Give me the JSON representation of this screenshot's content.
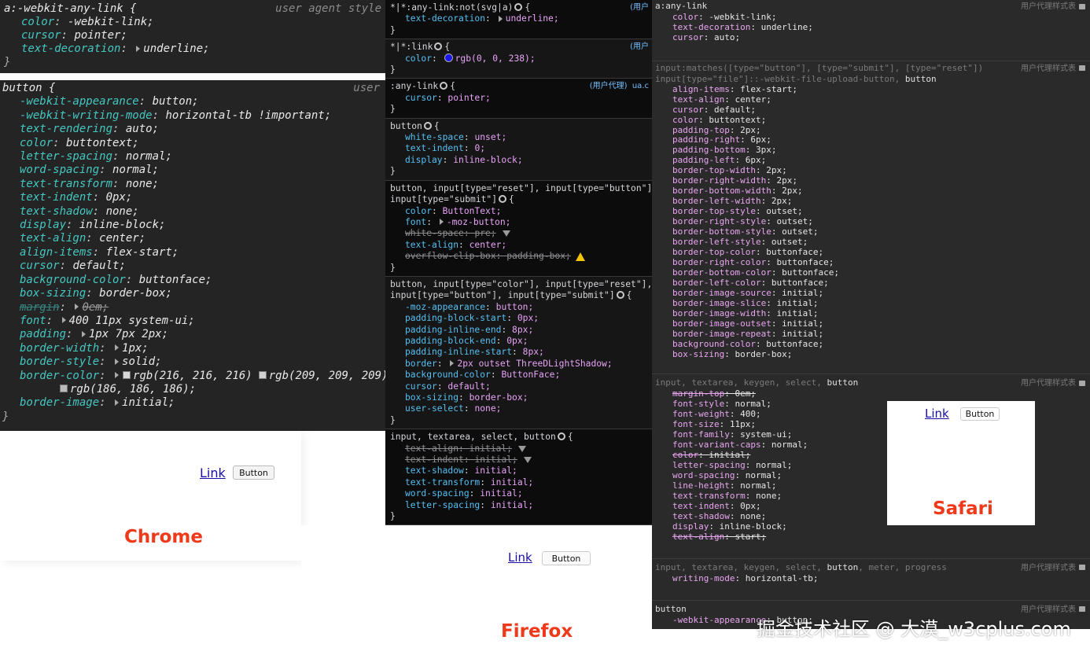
{
  "chrome": {
    "rule1": {
      "selector": "a:-webkit-any-link {",
      "source": "user agent style",
      "decls": [
        [
          "color",
          "-webkit-link;"
        ],
        [
          "cursor",
          "pointer;"
        ],
        [
          "text-decoration",
          "underline;"
        ]
      ],
      "close": "}"
    },
    "rule2": {
      "selector": "button {",
      "source": "user",
      "decls": [
        [
          "-webkit-appearance",
          "button;"
        ],
        [
          "-webkit-writing-mode",
          "horizontal-tb !important;"
        ],
        [
          "text-rendering",
          "auto;"
        ],
        [
          "color",
          "buttontext;"
        ],
        [
          "letter-spacing",
          "normal;"
        ],
        [
          "word-spacing",
          "normal;"
        ],
        [
          "text-transform",
          "none;"
        ],
        [
          "text-indent",
          "0px;"
        ],
        [
          "text-shadow",
          "none;"
        ],
        [
          "display",
          "inline-block;"
        ],
        [
          "text-align",
          "center;"
        ],
        [
          "align-items",
          "flex-start;"
        ],
        [
          "cursor",
          "default;"
        ],
        [
          "background-color",
          "buttonface;"
        ],
        [
          "box-sizing",
          "border-box;"
        ],
        [
          "margin",
          "0em;"
        ],
        [
          "font",
          "400 11px system-ui;"
        ],
        [
          "padding",
          "1px 7px 2px;"
        ],
        [
          "border-width",
          "1px;"
        ],
        [
          "border-style",
          "solid;"
        ],
        [
          "border-color",
          "rgb(216, 216, 216)"
        ],
        [
          "border-image",
          "initial;"
        ]
      ],
      "border_color_second": "rgb(209, 209, 209)",
      "border_color_third": "rgb(186, 186, 186);",
      "close": "}"
    },
    "demo": {
      "link": "Link",
      "button": "Button"
    },
    "label": "Chrome"
  },
  "firefox": {
    "rules": [
      {
        "selector": "*|*:any-link:not(svg|a)",
        "source": "(用户",
        "decls": [
          [
            "text-decoration",
            "underline;"
          ]
        ]
      },
      {
        "selector": "*|*:link",
        "source": "(用户",
        "decls": [
          [
            "color",
            "rgb(0, 0, 238);"
          ]
        ]
      },
      {
        "selector": ":any-link",
        "source": "(用户代理)  ua.c",
        "decls": [
          [
            "cursor",
            "pointer;"
          ]
        ]
      },
      {
        "selector": "button",
        "source": "",
        "decls": [
          [
            "white-space",
            "unset;"
          ],
          [
            "text-indent",
            "0;"
          ],
          [
            "display",
            "inline-block;"
          ]
        ]
      },
      {
        "selector1": "button, input[type=\"reset\"], input[type=\"button\"],",
        "selector": "input[type=\"submit\"]",
        "source": "",
        "decls": [
          [
            "color",
            "ButtonText;"
          ],
          [
            "font",
            "-moz-button;"
          ],
          [
            "white-space",
            "pre;"
          ],
          [
            "text-align",
            "center;"
          ],
          [
            "overflow-clip-box",
            "padding-box;"
          ]
        ]
      },
      {
        "selector1": "button, input[type=\"color\"], input[type=\"reset\"],",
        "selector": "input[type=\"button\"], input[type=\"submit\"]",
        "source": "",
        "decls": [
          [
            "-moz-appearance",
            "button;"
          ],
          [
            "padding-block-start",
            "0px;"
          ],
          [
            "padding-inline-end",
            "8px;"
          ],
          [
            "padding-block-end",
            "0px;"
          ],
          [
            "padding-inline-start",
            "8px;"
          ],
          [
            "border",
            "2px outset ThreeDLightShadow;"
          ],
          [
            "background-color",
            "ButtonFace;"
          ],
          [
            "cursor",
            "default;"
          ],
          [
            "box-sizing",
            "border-box;"
          ],
          [
            "user-select",
            "none;"
          ]
        ]
      },
      {
        "selector": "input, textarea, select, button",
        "source": "",
        "decls": [
          [
            "text-align",
            "initial;"
          ],
          [
            "text-indent",
            "initial;"
          ],
          [
            "text-shadow",
            "initial;"
          ],
          [
            "text-transform",
            "initial;"
          ],
          [
            "word-spacing",
            "initial;"
          ],
          [
            "letter-spacing",
            "initial;"
          ]
        ]
      }
    ],
    "demo": {
      "link": "Link",
      "button": "Button"
    },
    "label": "Firefox"
  },
  "safari": {
    "source_label": "用户代理样式表",
    "rule1": {
      "selector": "a:any-link",
      "decls": [
        [
          "color",
          "-webkit-link;"
        ],
        [
          "text-decoration",
          "underline;"
        ],
        [
          "cursor",
          "auto;"
        ]
      ]
    },
    "rule2": {
      "line1": "input:matches([type=\"button\"], [type=\"submit\"], [type=\"reset\"])",
      "line2a": "input[type=\"file\"]::-webkit-file-upload-button, ",
      "line2b": "button",
      "decls": [
        [
          "align-items",
          "flex-start;"
        ],
        [
          "text-align",
          "center;"
        ],
        [
          "cursor",
          "default;"
        ],
        [
          "color",
          "buttontext;"
        ],
        [
          "padding-top",
          "2px;"
        ],
        [
          "padding-right",
          "6px;"
        ],
        [
          "padding-bottom",
          "3px;"
        ],
        [
          "padding-left",
          "6px;"
        ],
        [
          "border-top-width",
          "2px;"
        ],
        [
          "border-right-width",
          "2px;"
        ],
        [
          "border-bottom-width",
          "2px;"
        ],
        [
          "border-left-width",
          "2px;"
        ],
        [
          "border-top-style",
          "outset;"
        ],
        [
          "border-right-style",
          "outset;"
        ],
        [
          "border-bottom-style",
          "outset;"
        ],
        [
          "border-left-style",
          "outset;"
        ],
        [
          "border-top-color",
          "buttonface;"
        ],
        [
          "border-right-color",
          "buttonface;"
        ],
        [
          "border-bottom-color",
          "buttonface;"
        ],
        [
          "border-left-color",
          "buttonface;"
        ],
        [
          "border-image-source",
          "initial;"
        ],
        [
          "border-image-slice",
          "initial;"
        ],
        [
          "border-image-width",
          "initial;"
        ],
        [
          "border-image-outset",
          "initial;"
        ],
        [
          "border-image-repeat",
          "initial;"
        ],
        [
          "background-color",
          "buttonface;"
        ],
        [
          "box-sizing",
          "border-box;"
        ]
      ]
    },
    "rule3": {
      "sel_dim": "input, textarea, keygen, select, ",
      "sel_hi": "button",
      "decls": [
        [
          "margin-top",
          "0em;"
        ],
        [
          "font-style",
          "normal;"
        ],
        [
          "font-weight",
          "400;"
        ],
        [
          "font-size",
          "11px;"
        ],
        [
          "font-family",
          "system-ui;"
        ],
        [
          "font-variant-caps",
          "normal;"
        ],
        [
          "color",
          "initial;"
        ],
        [
          "letter-spacing",
          "normal;"
        ],
        [
          "word-spacing",
          "normal;"
        ],
        [
          "line-height",
          "normal;"
        ],
        [
          "text-transform",
          "none;"
        ],
        [
          "text-indent",
          "0px;"
        ],
        [
          "text-shadow",
          "none;"
        ],
        [
          "display",
          "inline-block;"
        ],
        [
          "text-align",
          "start;"
        ]
      ]
    },
    "rule4": {
      "sel_dim": "input, textarea, keygen, select, ",
      "sel_hi": "button",
      "sel_dim2": ", meter, progress",
      "decls": [
        [
          "writing-mode",
          "horizontal-tb;"
        ]
      ]
    },
    "rule5": {
      "selector": "button",
      "decls": [
        [
          "-webkit-appearance",
          "button;"
        ]
      ]
    },
    "demo": {
      "link": "Link",
      "button": "Button"
    },
    "label": "Safari"
  },
  "watermark": "掘金技术社区 @ 大漠_w3cplus.com",
  "colors": {
    "prop_chrome": "#45c7c1",
    "prop_ff": "#55c0f2",
    "val_ff": "#e8a3f7",
    "prop_sf": "#e9a6f1",
    "label": "#ee3a1a",
    "link": "#1a0dab"
  }
}
